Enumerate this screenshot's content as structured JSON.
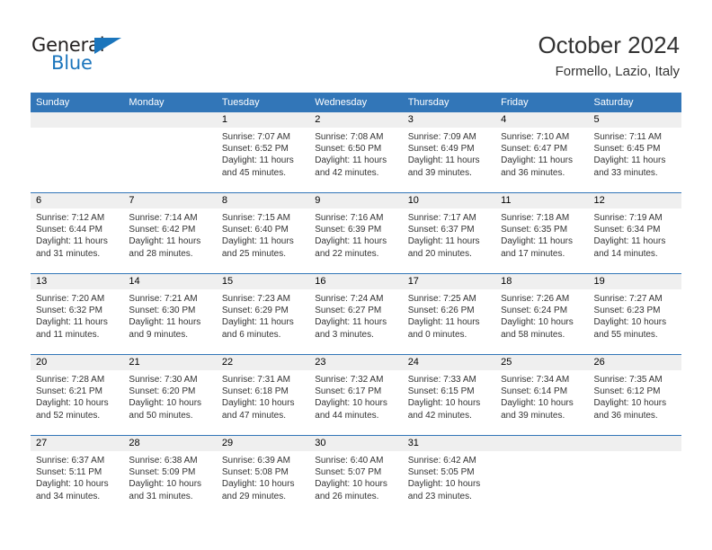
{
  "brand": {
    "name_top": "General",
    "name_bottom": "Blue",
    "color_blue": "#1b75bc",
    "color_dark": "#221f1f"
  },
  "header": {
    "title": "October 2024",
    "subtitle": "Formello, Lazio, Italy"
  },
  "theme": {
    "header_blue": "#3276b8",
    "daynum_band": "#efefef",
    "row_rule": "#3276b8",
    "text": "#333333"
  },
  "weekdays": [
    "Sunday",
    "Monday",
    "Tuesday",
    "Wednesday",
    "Thursday",
    "Friday",
    "Saturday"
  ],
  "weeks": [
    [
      {
        "day": "",
        "lines": []
      },
      {
        "day": "",
        "lines": []
      },
      {
        "day": "1",
        "lines": [
          "Sunrise: 7:07 AM",
          "Sunset: 6:52 PM",
          "Daylight: 11 hours",
          "and 45 minutes."
        ]
      },
      {
        "day": "2",
        "lines": [
          "Sunrise: 7:08 AM",
          "Sunset: 6:50 PM",
          "Daylight: 11 hours",
          "and 42 minutes."
        ]
      },
      {
        "day": "3",
        "lines": [
          "Sunrise: 7:09 AM",
          "Sunset: 6:49 PM",
          "Daylight: 11 hours",
          "and 39 minutes."
        ]
      },
      {
        "day": "4",
        "lines": [
          "Sunrise: 7:10 AM",
          "Sunset: 6:47 PM",
          "Daylight: 11 hours",
          "and 36 minutes."
        ]
      },
      {
        "day": "5",
        "lines": [
          "Sunrise: 7:11 AM",
          "Sunset: 6:45 PM",
          "Daylight: 11 hours",
          "and 33 minutes."
        ]
      }
    ],
    [
      {
        "day": "6",
        "lines": [
          "Sunrise: 7:12 AM",
          "Sunset: 6:44 PM",
          "Daylight: 11 hours",
          "and 31 minutes."
        ]
      },
      {
        "day": "7",
        "lines": [
          "Sunrise: 7:14 AM",
          "Sunset: 6:42 PM",
          "Daylight: 11 hours",
          "and 28 minutes."
        ]
      },
      {
        "day": "8",
        "lines": [
          "Sunrise: 7:15 AM",
          "Sunset: 6:40 PM",
          "Daylight: 11 hours",
          "and 25 minutes."
        ]
      },
      {
        "day": "9",
        "lines": [
          "Sunrise: 7:16 AM",
          "Sunset: 6:39 PM",
          "Daylight: 11 hours",
          "and 22 minutes."
        ]
      },
      {
        "day": "10",
        "lines": [
          "Sunrise: 7:17 AM",
          "Sunset: 6:37 PM",
          "Daylight: 11 hours",
          "and 20 minutes."
        ]
      },
      {
        "day": "11",
        "lines": [
          "Sunrise: 7:18 AM",
          "Sunset: 6:35 PM",
          "Daylight: 11 hours",
          "and 17 minutes."
        ]
      },
      {
        "day": "12",
        "lines": [
          "Sunrise: 7:19 AM",
          "Sunset: 6:34 PM",
          "Daylight: 11 hours",
          "and 14 minutes."
        ]
      }
    ],
    [
      {
        "day": "13",
        "lines": [
          "Sunrise: 7:20 AM",
          "Sunset: 6:32 PM",
          "Daylight: 11 hours",
          "and 11 minutes."
        ]
      },
      {
        "day": "14",
        "lines": [
          "Sunrise: 7:21 AM",
          "Sunset: 6:30 PM",
          "Daylight: 11 hours",
          "and 9 minutes."
        ]
      },
      {
        "day": "15",
        "lines": [
          "Sunrise: 7:23 AM",
          "Sunset: 6:29 PM",
          "Daylight: 11 hours",
          "and 6 minutes."
        ]
      },
      {
        "day": "16",
        "lines": [
          "Sunrise: 7:24 AM",
          "Sunset: 6:27 PM",
          "Daylight: 11 hours",
          "and 3 minutes."
        ]
      },
      {
        "day": "17",
        "lines": [
          "Sunrise: 7:25 AM",
          "Sunset: 6:26 PM",
          "Daylight: 11 hours",
          "and 0 minutes."
        ]
      },
      {
        "day": "18",
        "lines": [
          "Sunrise: 7:26 AM",
          "Sunset: 6:24 PM",
          "Daylight: 10 hours",
          "and 58 minutes."
        ]
      },
      {
        "day": "19",
        "lines": [
          "Sunrise: 7:27 AM",
          "Sunset: 6:23 PM",
          "Daylight: 10 hours",
          "and 55 minutes."
        ]
      }
    ],
    [
      {
        "day": "20",
        "lines": [
          "Sunrise: 7:28 AM",
          "Sunset: 6:21 PM",
          "Daylight: 10 hours",
          "and 52 minutes."
        ]
      },
      {
        "day": "21",
        "lines": [
          "Sunrise: 7:30 AM",
          "Sunset: 6:20 PM",
          "Daylight: 10 hours",
          "and 50 minutes."
        ]
      },
      {
        "day": "22",
        "lines": [
          "Sunrise: 7:31 AM",
          "Sunset: 6:18 PM",
          "Daylight: 10 hours",
          "and 47 minutes."
        ]
      },
      {
        "day": "23",
        "lines": [
          "Sunrise: 7:32 AM",
          "Sunset: 6:17 PM",
          "Daylight: 10 hours",
          "and 44 minutes."
        ]
      },
      {
        "day": "24",
        "lines": [
          "Sunrise: 7:33 AM",
          "Sunset: 6:15 PM",
          "Daylight: 10 hours",
          "and 42 minutes."
        ]
      },
      {
        "day": "25",
        "lines": [
          "Sunrise: 7:34 AM",
          "Sunset: 6:14 PM",
          "Daylight: 10 hours",
          "and 39 minutes."
        ]
      },
      {
        "day": "26",
        "lines": [
          "Sunrise: 7:35 AM",
          "Sunset: 6:12 PM",
          "Daylight: 10 hours",
          "and 36 minutes."
        ]
      }
    ],
    [
      {
        "day": "27",
        "lines": [
          "Sunrise: 6:37 AM",
          "Sunset: 5:11 PM",
          "Daylight: 10 hours",
          "and 34 minutes."
        ]
      },
      {
        "day": "28",
        "lines": [
          "Sunrise: 6:38 AM",
          "Sunset: 5:09 PM",
          "Daylight: 10 hours",
          "and 31 minutes."
        ]
      },
      {
        "day": "29",
        "lines": [
          "Sunrise: 6:39 AM",
          "Sunset: 5:08 PM",
          "Daylight: 10 hours",
          "and 29 minutes."
        ]
      },
      {
        "day": "30",
        "lines": [
          "Sunrise: 6:40 AM",
          "Sunset: 5:07 PM",
          "Daylight: 10 hours",
          "and 26 minutes."
        ]
      },
      {
        "day": "31",
        "lines": [
          "Sunrise: 6:42 AM",
          "Sunset: 5:05 PM",
          "Daylight: 10 hours",
          "and 23 minutes."
        ]
      },
      {
        "day": "",
        "lines": []
      },
      {
        "day": "",
        "lines": []
      }
    ]
  ]
}
